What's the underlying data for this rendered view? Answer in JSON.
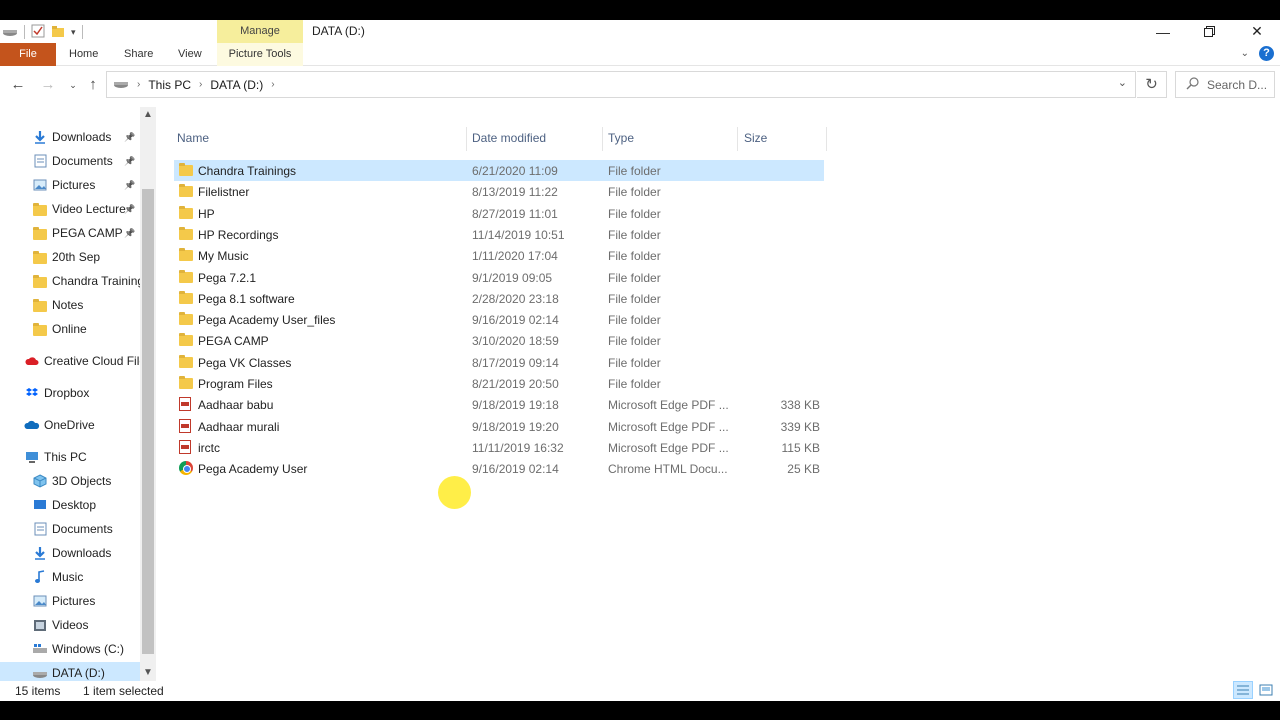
{
  "title_bar": {
    "contextual_tab": "Manage",
    "window_title": "DATA (D:)",
    "minimize_icon": "minimize-icon",
    "restore_icon": "restore-icon",
    "close_icon": "close-icon"
  },
  "ribbon": {
    "tabs": [
      "File",
      "Home",
      "Share",
      "View",
      "Picture Tools"
    ]
  },
  "address_bar": {
    "crumbs": [
      "This PC",
      "DATA (D:)"
    ],
    "search_placeholder": "Search D..."
  },
  "sidebar": {
    "quick_access": [
      {
        "label": "Downloads",
        "icon": "download-arrow-icon",
        "pinned": true
      },
      {
        "label": "Documents",
        "icon": "documents-icon",
        "pinned": true
      },
      {
        "label": "Pictures",
        "icon": "pictures-icon",
        "pinned": true
      },
      {
        "label": "Video Lecture",
        "icon": "folder-icon",
        "pinned": true
      },
      {
        "label": "PEGA CAMP",
        "icon": "folder-icon",
        "pinned": true
      },
      {
        "label": "20th Sep",
        "icon": "folder-icon",
        "pinned": false
      },
      {
        "label": "Chandra Training",
        "icon": "folder-icon",
        "pinned": false
      },
      {
        "label": "Notes",
        "icon": "folder-icon",
        "pinned": false
      },
      {
        "label": "Online",
        "icon": "folder-icon",
        "pinned": false
      }
    ],
    "creative_cloud": "Creative Cloud File",
    "dropbox": "Dropbox",
    "onedrive": "OneDrive",
    "this_pc": "This PC",
    "this_pc_items": [
      {
        "label": "3D Objects",
        "icon": "3d-objects-icon"
      },
      {
        "label": "Desktop",
        "icon": "desktop-icon"
      },
      {
        "label": "Documents",
        "icon": "documents-icon"
      },
      {
        "label": "Downloads",
        "icon": "download-arrow-icon"
      },
      {
        "label": "Music",
        "icon": "music-icon"
      },
      {
        "label": "Pictures",
        "icon": "pictures-icon"
      },
      {
        "label": "Videos",
        "icon": "videos-icon"
      },
      {
        "label": "Windows (C:)",
        "icon": "windows-drive-icon"
      },
      {
        "label": "DATA (D:)",
        "icon": "drive-icon"
      }
    ]
  },
  "columns": [
    "Name",
    "Date modified",
    "Type",
    "Size"
  ],
  "files": [
    {
      "name": "Chandra Trainings",
      "date": "6/21/2020 11:09",
      "type": "File folder",
      "size": "",
      "icon": "folder-icon",
      "selected": true
    },
    {
      "name": "Filelistner",
      "date": "8/13/2019 11:22",
      "type": "File folder",
      "size": "",
      "icon": "folder-icon"
    },
    {
      "name": "HP",
      "date": "8/27/2019 11:01",
      "type": "File folder",
      "size": "",
      "icon": "folder-icon"
    },
    {
      "name": "HP Recordings",
      "date": "11/14/2019 10:51",
      "type": "File folder",
      "size": "",
      "icon": "folder-icon"
    },
    {
      "name": "My Music",
      "date": "1/11/2020 17:04",
      "type": "File folder",
      "size": "",
      "icon": "folder-icon"
    },
    {
      "name": "Pega 7.2.1",
      "date": "9/1/2019 09:05",
      "type": "File folder",
      "size": "",
      "icon": "folder-icon"
    },
    {
      "name": "Pega 8.1 software",
      "date": "2/28/2020 23:18",
      "type": "File folder",
      "size": "",
      "icon": "folder-icon"
    },
    {
      "name": "Pega Academy User_files",
      "date": "9/16/2019 02:14",
      "type": "File folder",
      "size": "",
      "icon": "folder-icon"
    },
    {
      "name": "PEGA CAMP",
      "date": "3/10/2020 18:59",
      "type": "File folder",
      "size": "",
      "icon": "folder-icon"
    },
    {
      "name": "Pega VK Classes",
      "date": "8/17/2019 09:14",
      "type": "File folder",
      "size": "",
      "icon": "folder-icon"
    },
    {
      "name": "Program Files",
      "date": "8/21/2019 20:50",
      "type": "File folder",
      "size": "",
      "icon": "folder-icon"
    },
    {
      "name": "Aadhaar babu",
      "date": "9/18/2019 19:18",
      "type": "Microsoft Edge PDF ...",
      "size": "338 KB",
      "icon": "pdf-icon"
    },
    {
      "name": "Aadhaar murali",
      "date": "9/18/2019 19:20",
      "type": "Microsoft Edge PDF ...",
      "size": "339 KB",
      "icon": "pdf-icon"
    },
    {
      "name": "irctc",
      "date": "11/11/2019 16:32",
      "type": "Microsoft Edge PDF ...",
      "size": "115 KB",
      "icon": "pdf-icon"
    },
    {
      "name": "Pega Academy User",
      "date": "9/16/2019 02:14",
      "type": "Chrome HTML Docu...",
      "size": "25 KB",
      "icon": "chrome-icon"
    }
  ],
  "status": {
    "item_count": "15 items",
    "selection": "1 item selected"
  },
  "colors": {
    "file_tab": "#c4541c",
    "manage_tab": "#f6ee9c",
    "selection": "#cce8ff",
    "header_text": "#4d6182"
  }
}
